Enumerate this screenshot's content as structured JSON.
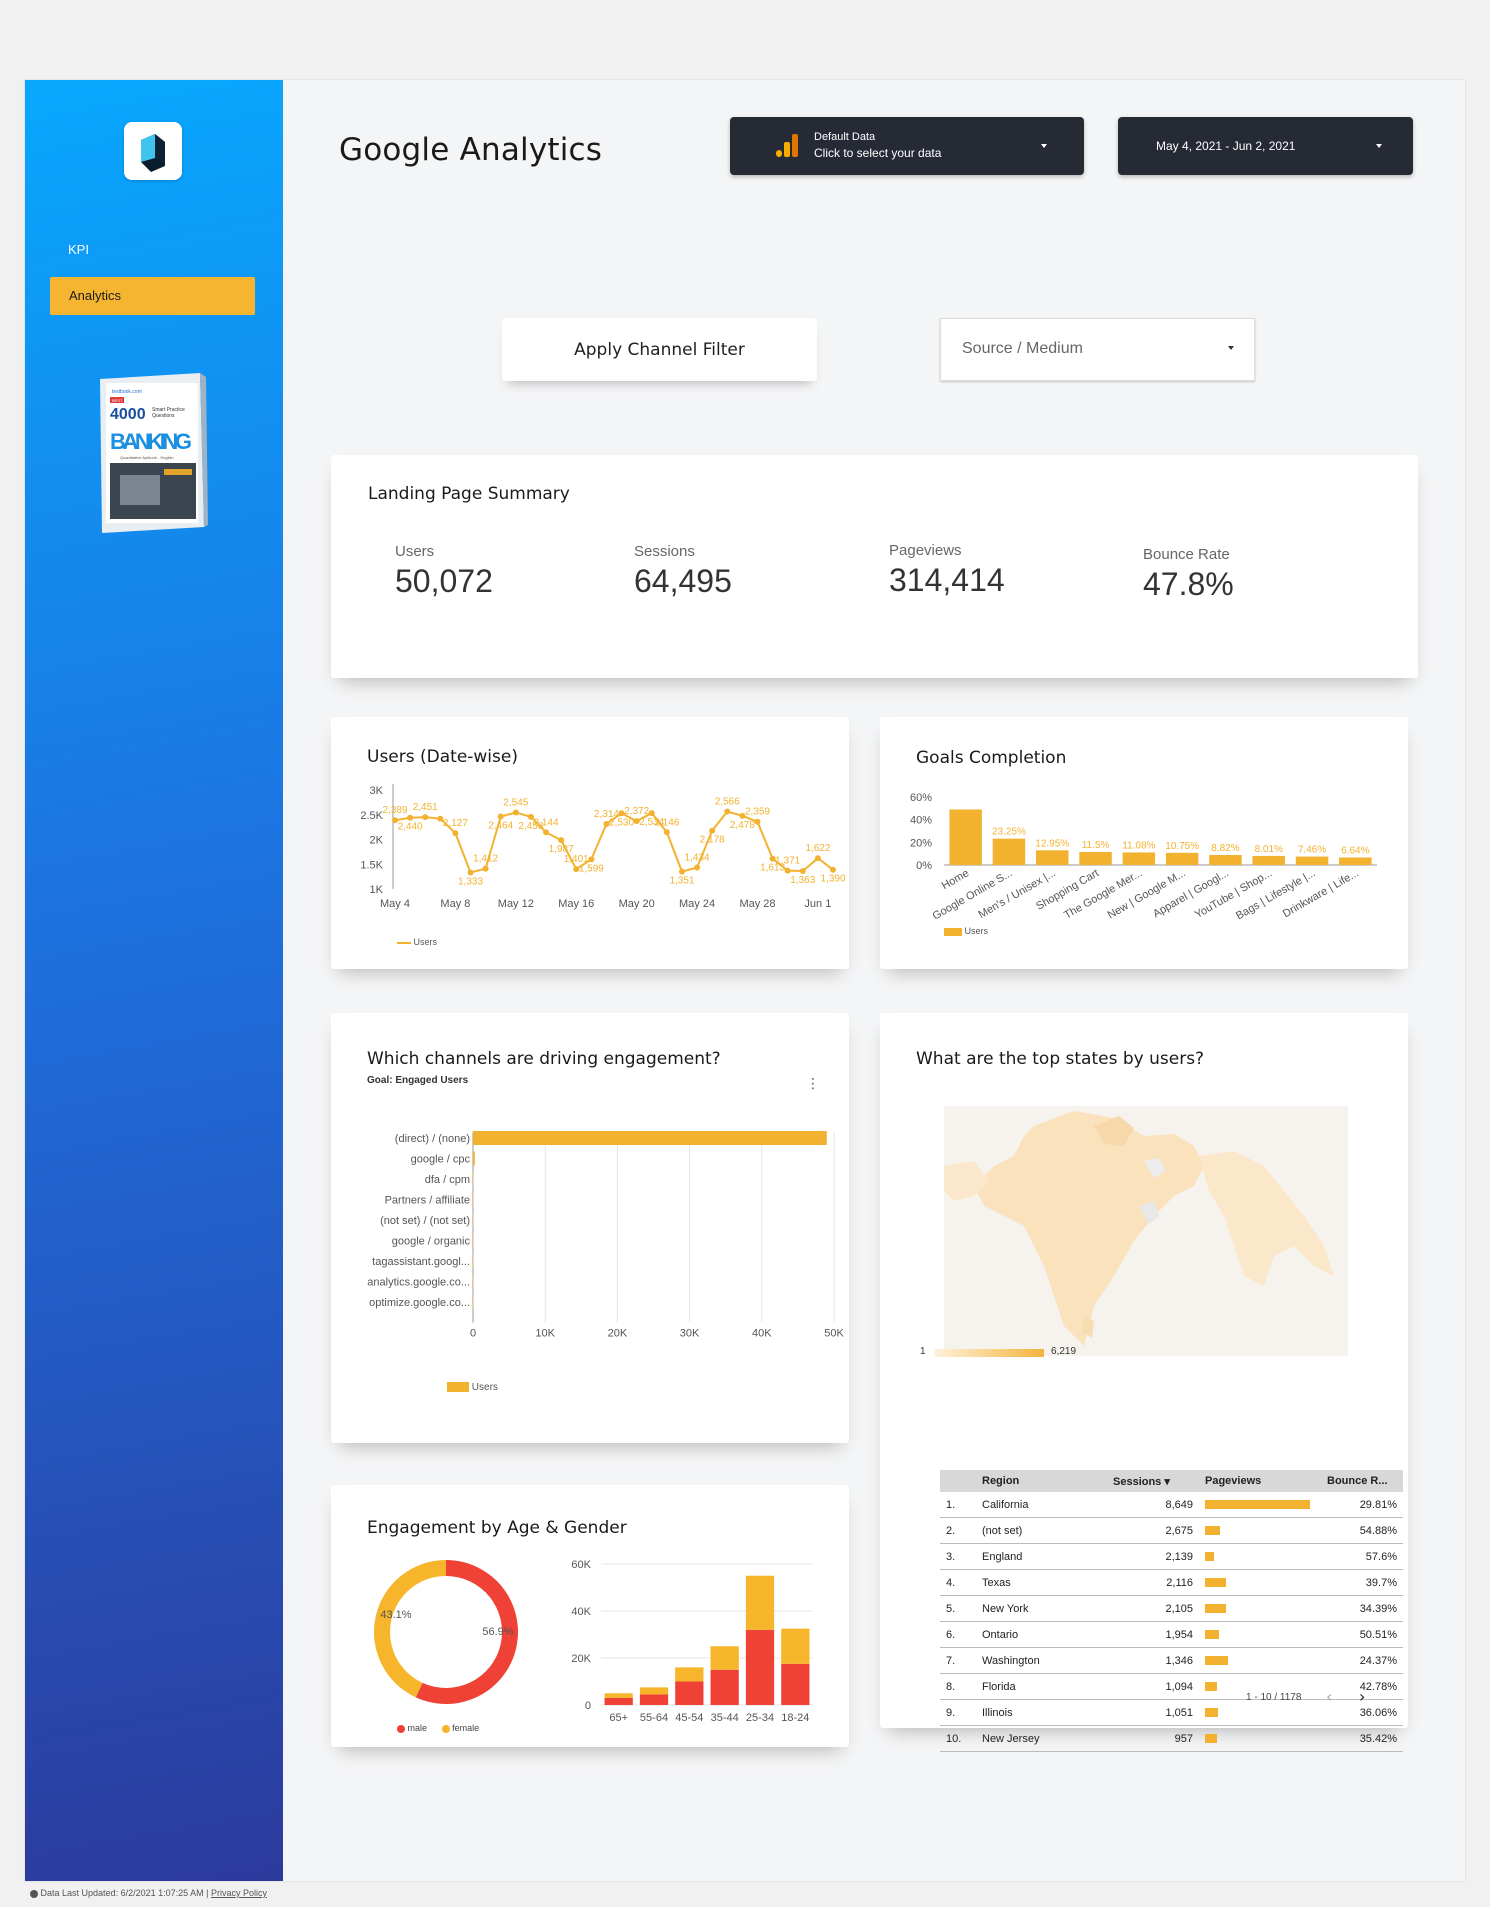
{
  "header": {
    "title": "Google Analytics",
    "data_source": {
      "line1": "Default Data",
      "line2": "Click to select your data"
    },
    "date_range": "May 4, 2021 - Jun 2, 2021"
  },
  "sidebar": {
    "items": [
      {
        "label": "KPI"
      },
      {
        "label": "Analytics",
        "active": true
      }
    ],
    "book": {
      "badge": "BEST",
      "brand": "testbook.com",
      "count": "4000",
      "subtitle_1": "Smart Practice",
      "subtitle_2": "Questions",
      "title": "BANKING",
      "tagline": "Quantitative Aptitude - English"
    }
  },
  "filters": {
    "apply_label": "Apply Channel Filter",
    "dropdown_label": "Source / Medium"
  },
  "summary": {
    "title": "Landing Page Summary",
    "metrics": [
      {
        "label": "Users",
        "value": "50,072"
      },
      {
        "label": "Sessions",
        "value": "64,495"
      },
      {
        "label": "Pageviews",
        "value": "314,414"
      },
      {
        "label": "Bounce Rate",
        "value": "47.8%"
      }
    ]
  },
  "users_chart": {
    "title": "Users (Date-wise)",
    "legend": "Users"
  },
  "goals_chart": {
    "title": "Goals Completion",
    "legend": "Users"
  },
  "channels_chart": {
    "title": "Which channels are driving engagement?",
    "subtitle": "Goal: Engaged Users",
    "legend": "Users"
  },
  "age_gender": {
    "title": "Engagement by Age & Gender",
    "legend_male": "male",
    "legend_female": "female",
    "donut_male": "56.9%",
    "donut_female": "43.1%"
  },
  "map": {
    "title": "What are the top states by users?",
    "scale_min": "1",
    "scale_max": "6,219"
  },
  "table": {
    "headers": [
      "Region",
      "Sessions ▾",
      "Pageviews",
      "Bounce R..."
    ],
    "rows": [
      {
        "n": "1.",
        "region": "California",
        "sessions": "8,649",
        "pv": 1.0,
        "bounce": "29.81%"
      },
      {
        "n": "2.",
        "region": "(not set)",
        "sessions": "2,675",
        "pv": 0.14,
        "bounce": "54.88%"
      },
      {
        "n": "3.",
        "region": "England",
        "sessions": "2,139",
        "pv": 0.09,
        "bounce": "57.6%"
      },
      {
        "n": "4.",
        "region": "Texas",
        "sessions": "2,116",
        "pv": 0.2,
        "bounce": "39.7%"
      },
      {
        "n": "5.",
        "region": "New York",
        "sessions": "2,105",
        "pv": 0.2,
        "bounce": "34.39%"
      },
      {
        "n": "6.",
        "region": "Ontario",
        "sessions": "1,954",
        "pv": 0.13,
        "bounce": "50.51%"
      },
      {
        "n": "7.",
        "region": "Washington",
        "sessions": "1,346",
        "pv": 0.22,
        "bounce": "24.37%"
      },
      {
        "n": "8.",
        "region": "Florida",
        "sessions": "1,094",
        "pv": 0.11,
        "bounce": "42.78%"
      },
      {
        "n": "9.",
        "region": "Illinois",
        "sessions": "1,051",
        "pv": 0.12,
        "bounce": "36.06%"
      },
      {
        "n": "10.",
        "region": "New Jersey",
        "sessions": "957",
        "pv": 0.11,
        "bounce": "35.42%"
      }
    ],
    "pagination": "1 - 10 / 1178"
  },
  "footer": {
    "updated": "Data Last Updated: 6/2/2021 1:07:25 AM",
    "privacy": "Privacy Policy"
  },
  "colors": {
    "accent": "#f2b230",
    "male": "#ef4136",
    "female": "#f7b52c",
    "dark": "#252a35"
  },
  "chart_data": [
    {
      "type": "line",
      "title": "Users (Date-wise)",
      "x": [
        "May 4",
        "May 5",
        "May 6",
        "May 7",
        "May 8",
        "May 9",
        "May 10",
        "May 11",
        "May 12",
        "May 13",
        "May 14",
        "May 15",
        "May 16",
        "May 17",
        "May 18",
        "May 19",
        "May 20",
        "May 21",
        "May 22",
        "May 23",
        "May 24",
        "May 25",
        "May 26",
        "May 27",
        "May 28",
        "May 29",
        "May 30",
        "May 31",
        "Jun 1",
        "Jun 2"
      ],
      "x_ticks": [
        "May 4",
        "May 8",
        "May 12",
        "May 16",
        "May 20",
        "May 24",
        "May 28",
        "Jun 1"
      ],
      "series": [
        {
          "name": "Users",
          "values": [
            2389,
            2440,
            2451,
            2420,
            2127,
            1333,
            1412,
            2464,
            2545,
            2458,
            2144,
            1987,
            1401,
            1599,
            2314,
            2530,
            2372,
            2534,
            2146,
            1351,
            1434,
            2178,
            2566,
            2478,
            2359,
            1613,
            1371,
            1363,
            1622,
            1390
          ]
        }
      ],
      "data_labels": [
        "2,389",
        "2,440",
        "2,451",
        "",
        "2,127",
        "1,333",
        "1,412",
        "2,464",
        "2,545",
        "2,458",
        "2,144",
        "1,987",
        "1,401",
        "1,599",
        "2,314",
        "2,530",
        "2,372",
        "2,534",
        "2,146",
        "1,351",
        "1,434",
        "2,178",
        "2,566",
        "2,478",
        "2,359",
        "1,613",
        "1,371",
        "1,363",
        "1,622",
        "1,390"
      ],
      "y_ticks": [
        "1K",
        "1.5K",
        "2K",
        "2.5K",
        "3K"
      ],
      "ylim": [
        1000,
        3000
      ]
    },
    {
      "type": "bar",
      "title": "Goals Completion",
      "categories": [
        "Home",
        "Google Online S...",
        "Men's / Unisex |...",
        "Shopping Cart",
        "The Google Mer...",
        "New | Google M...",
        "Apparel | Googl...",
        "YouTube | Shop...",
        "Bags | Lifestyle |...",
        "Drinkware | Life..."
      ],
      "series": [
        {
          "name": "Users",
          "values": [
            49,
            23.25,
            12.95,
            11.5,
            11.08,
            10.75,
            8.82,
            8.01,
            7.46,
            6.64
          ]
        }
      ],
      "data_labels": [
        "",
        "23.25%",
        "12.95%",
        "11.5%",
        "11.08%",
        "10.75%",
        "8.82%",
        "8.01%",
        "7.46%",
        "6.64%"
      ],
      "y_ticks": [
        "0%",
        "20%",
        "40%",
        "60%"
      ],
      "ylim": [
        0,
        60
      ]
    },
    {
      "type": "bar",
      "orientation": "horizontal",
      "title": "Which channels are driving engagement?",
      "categories": [
        "(direct) / (none)",
        "google / cpc",
        "dfa / cpm",
        "Partners / affiliate",
        "(not set) / (not set)",
        "google / organic",
        "tagassistant.googl...",
        "analytics.google.co...",
        "optimize.google.co..."
      ],
      "series": [
        {
          "name": "Users",
          "values": [
            49000,
            250,
            40,
            20,
            10,
            5,
            2,
            1,
            1
          ]
        }
      ],
      "x_ticks": [
        "0",
        "10K",
        "20K",
        "30K",
        "40K",
        "50K"
      ],
      "xlim": [
        0,
        50000
      ]
    },
    {
      "type": "pie",
      "categories": [
        "male",
        "female"
      ],
      "values": [
        56.9,
        43.1
      ]
    },
    {
      "type": "bar",
      "stacked": true,
      "categories": [
        "65+",
        "55-64",
        "45-54",
        "35-44",
        "25-34",
        "18-24"
      ],
      "series": [
        {
          "name": "male",
          "values": [
            3000,
            4500,
            10000,
            15000,
            32000,
            17500
          ]
        },
        {
          "name": "female",
          "values": [
            2000,
            3000,
            6000,
            10000,
            23000,
            15000
          ]
        }
      ],
      "y_ticks": [
        "0",
        "20K",
        "40K",
        "60K"
      ],
      "ylim": [
        0,
        60000
      ]
    }
  ]
}
